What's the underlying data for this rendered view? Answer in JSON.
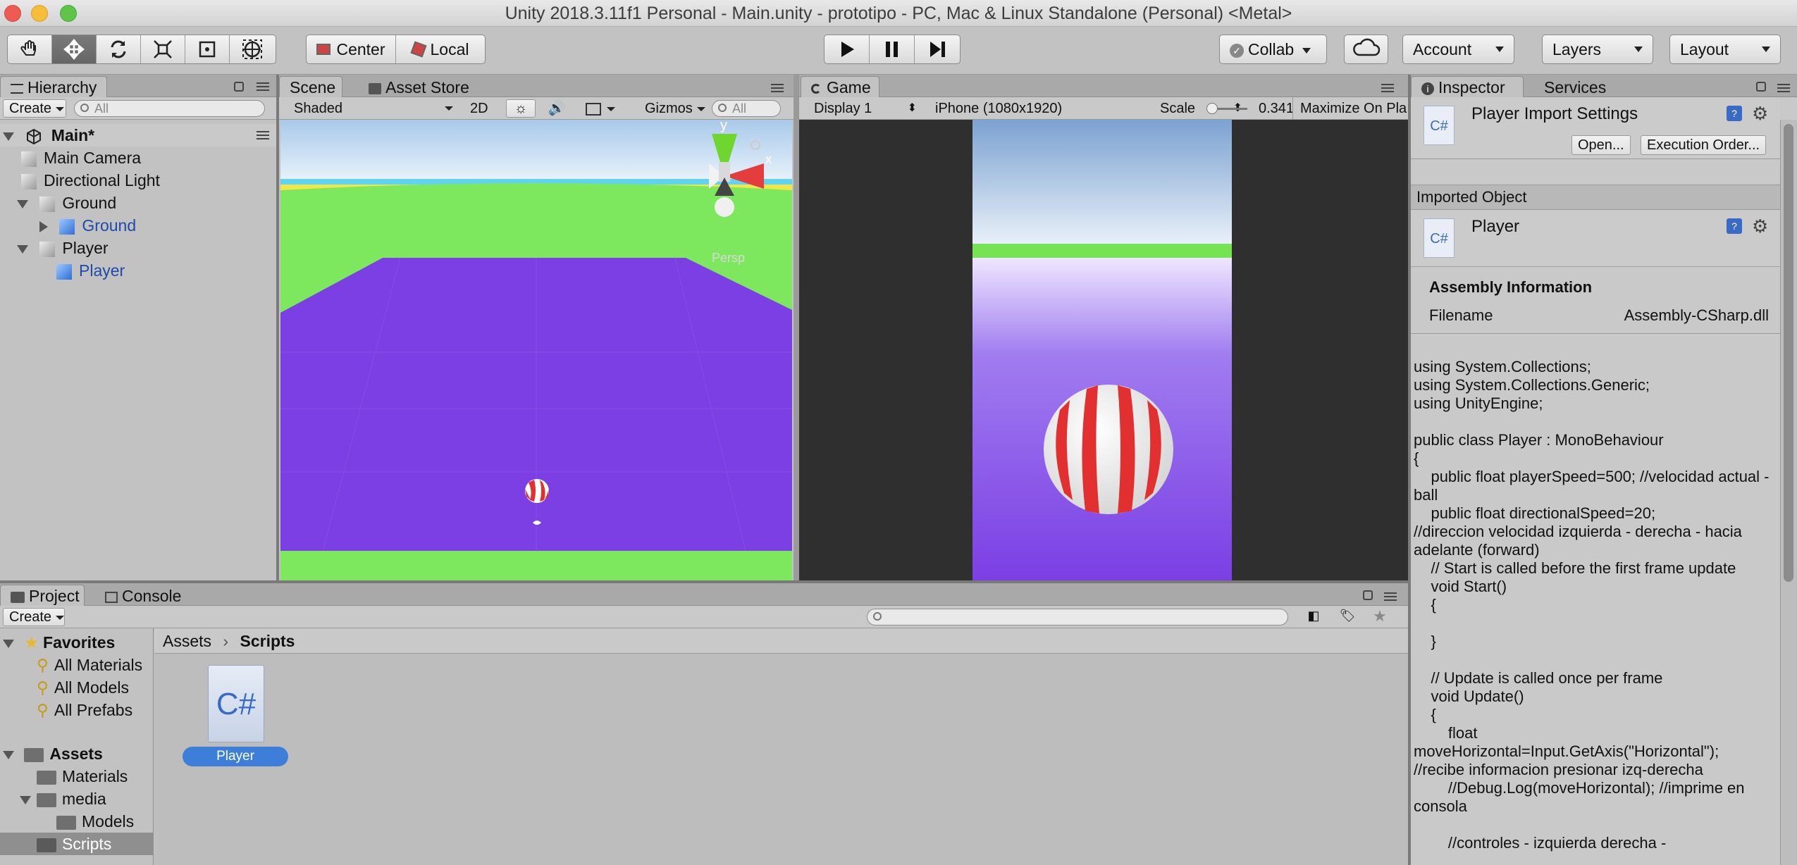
{
  "window": {
    "title": "Unity 2018.3.11f1 Personal - Main.unity - prototipo - PC, Mac & Linux Standalone (Personal) <Metal>"
  },
  "toolbar": {
    "tools": [
      "hand-tool",
      "move-tool",
      "rotate-tool",
      "scale-tool",
      "rect-tool",
      "transform-tool"
    ],
    "pivot": "Center",
    "space": "Local",
    "collab": "Collab",
    "account": "Account",
    "layers": "Layers",
    "layout": "Layout"
  },
  "hierarchy": {
    "tab": "Hierarchy",
    "create": "Create",
    "search_placeholder": "All",
    "scene": "Main*",
    "items": [
      "Main Camera",
      "Directional Light",
      "Ground",
      "Ground",
      "Player",
      "Player"
    ]
  },
  "scene": {
    "tabs": [
      "Scene",
      "Asset Store"
    ],
    "shading": "Shaded",
    "mode2d": "2D",
    "gizmos": "Gizmos",
    "search_placeholder": "All",
    "axis_y": "y",
    "axis_x": "x",
    "persp": "Persp"
  },
  "game": {
    "tab": "Game",
    "display": "Display 1",
    "resolution": "iPhone (1080x1920)",
    "scale_label": "Scale",
    "scale_value": "0.341",
    "scale_fraction": 0.1,
    "maximize": "Maximize On Pla"
  },
  "inspector": {
    "tabs": [
      "Inspector",
      "Services"
    ],
    "header_title": "Player Import Settings",
    "open_button": "Open...",
    "exec_button": "Execution Order...",
    "imported_object": "Imported Object",
    "object_name": "Player",
    "file_icon_text": "C#",
    "assembly_title": "Assembly Information",
    "filename_label": "Filename",
    "filename_value": "Assembly-CSharp.dll",
    "code": "using System.Collections;\nusing System.Collections.Generic;\nusing UnityEngine;\n\npublic class Player : MonoBehaviour\n{\n    public float playerSpeed=500; //velocidad actual - ball\n    public float directionalSpeed=20;\n//direccion velocidad izquierda - derecha - hacia adelante (forward)\n    // Start is called before the first frame update\n    void Start()\n    {\n\n    }\n\n    // Update is called once per frame\n    void Update()\n    {\n        float\nmoveHorizontal=Input.GetAxis(\"Horizontal\");\n//recibe informacion presionar izq-derecha\n        //Debug.Log(moveHorizontal); //imprime en consola\n\n        //controles - izquierda derecha -"
  },
  "project": {
    "tabs": [
      "Project",
      "Console"
    ],
    "create": "Create",
    "breadcrumb": [
      "Assets",
      "Scripts"
    ],
    "favorites_label": "Favorites",
    "favorites": [
      "All Materials",
      "All Models",
      "All Prefabs"
    ],
    "assets_label": "Assets",
    "folders": [
      "Materials",
      "media",
      "Models",
      "Scripts"
    ],
    "asset_name": "Player",
    "asset_icon_text": "C#"
  },
  "colors": {
    "ground": "#7b3fe4",
    "grass": "#7de85e",
    "ball_red": "#e23030",
    "selection": "#3d7fd8"
  }
}
